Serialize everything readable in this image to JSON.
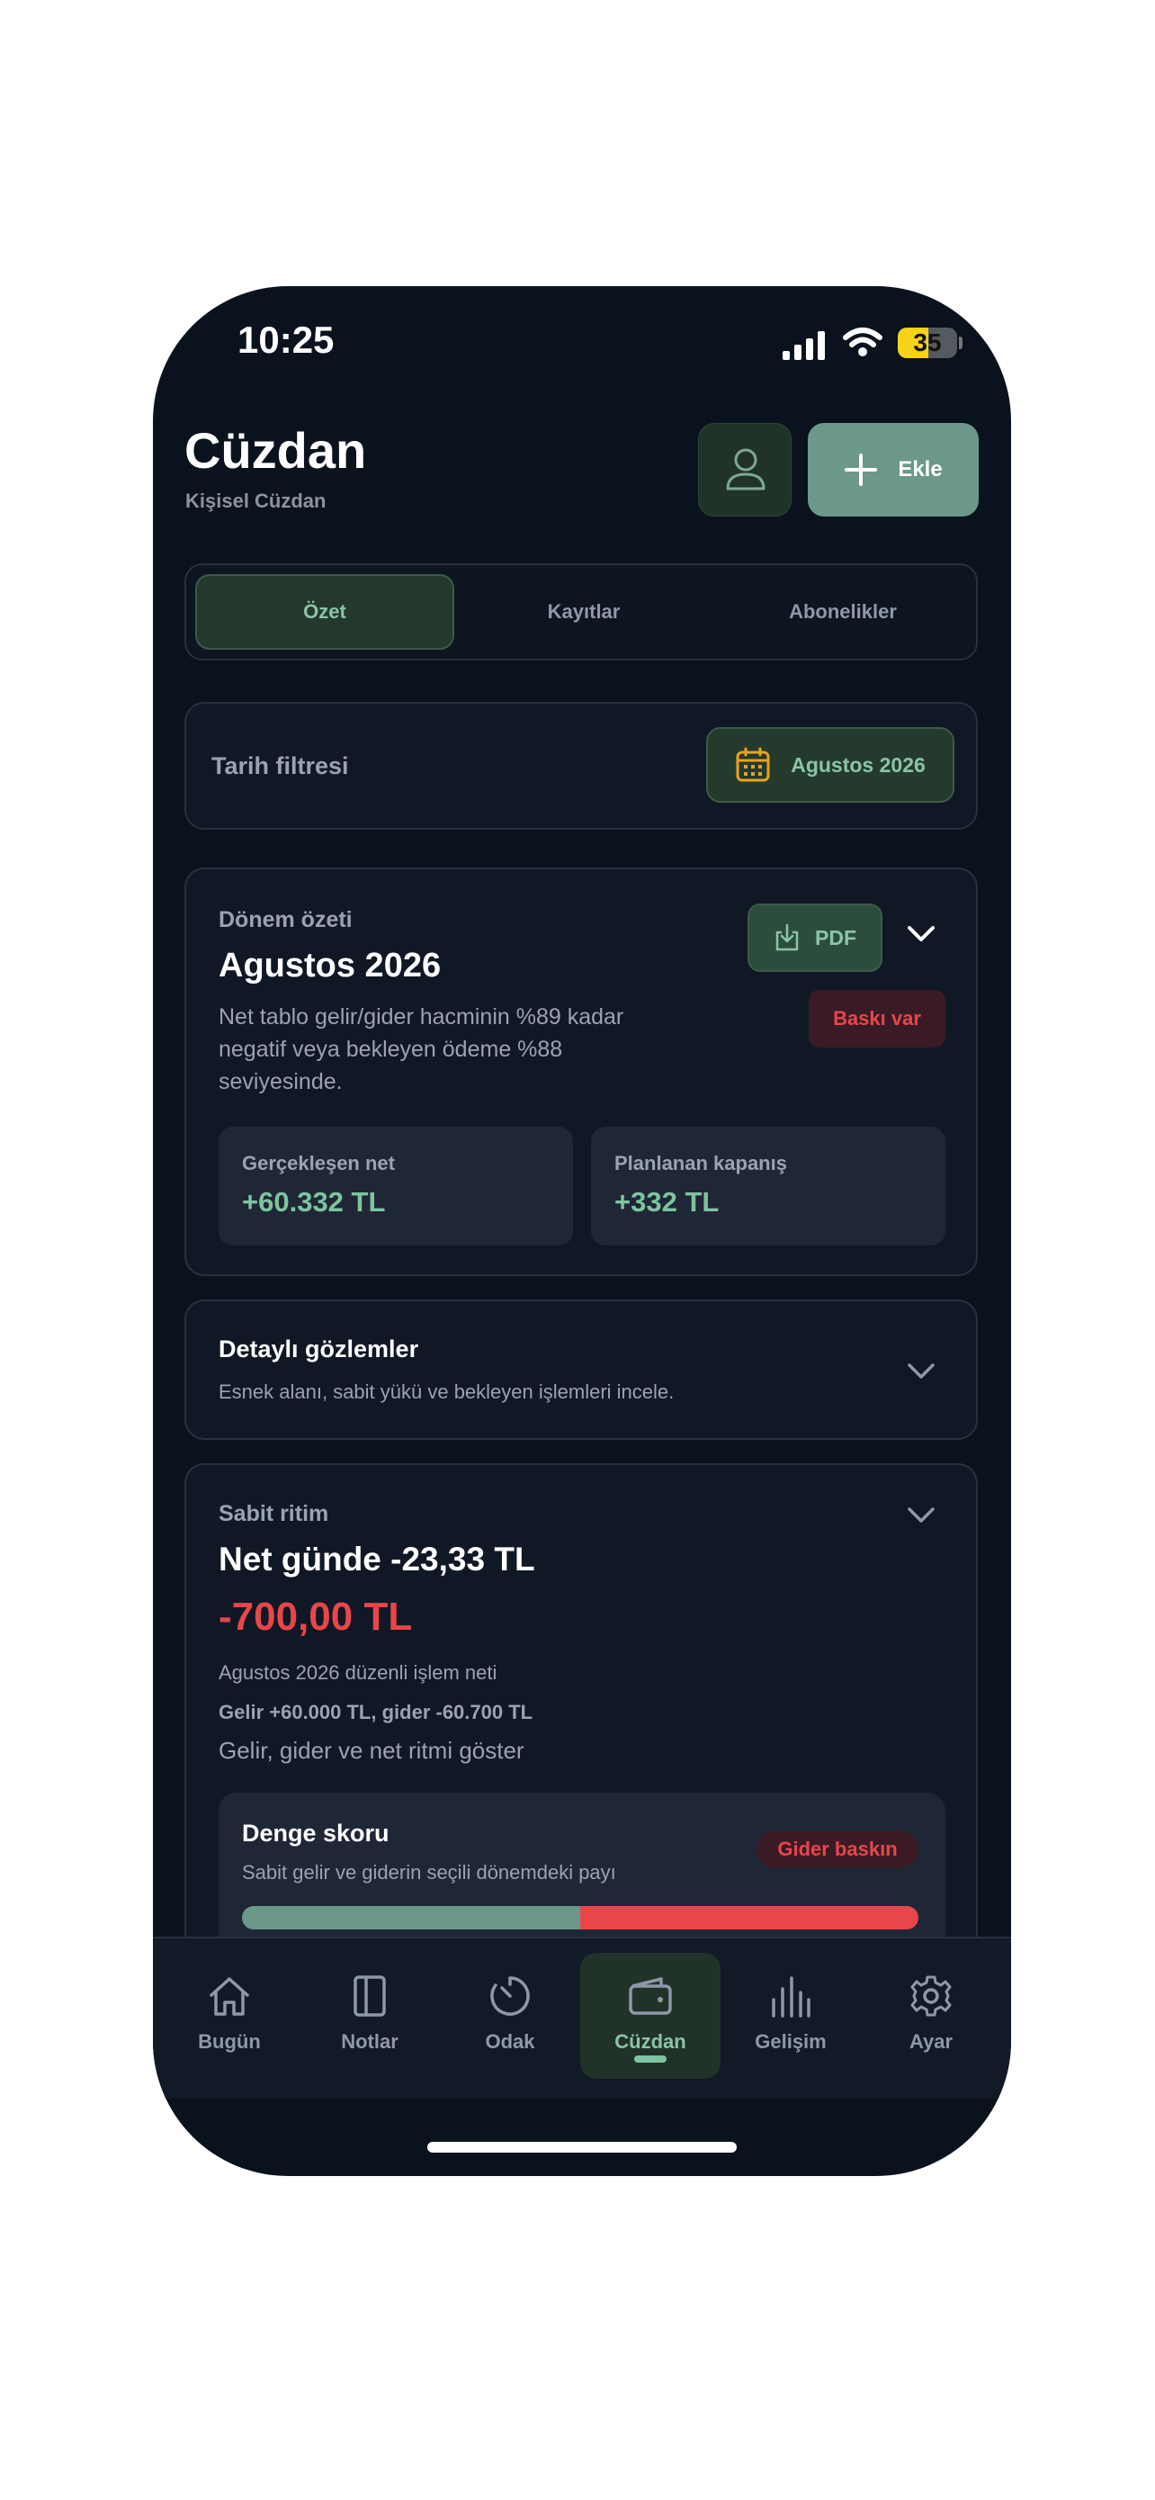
{
  "status": {
    "time": "10:25",
    "battery": "35"
  },
  "header": {
    "title": "Cüzdan",
    "subtitle": "Kişisel Cüzdan",
    "add_label": "Ekle"
  },
  "tabs": [
    {
      "label": "Özet",
      "active": true
    },
    {
      "label": "Kayıtlar",
      "active": false
    },
    {
      "label": "Abonelikler",
      "active": false
    }
  ],
  "filter": {
    "label": "Tarih filtresi",
    "date": "Agustos 2026"
  },
  "summary": {
    "section_label": "Dönem özeti",
    "period": "Agustos 2026",
    "description": "Net tablo gelir/gider hacminin %89 kadar negatif veya bekleyen ödeme %88 seviyesinde.",
    "pdf_label": "PDF",
    "badge": "Baskı var",
    "cards": [
      {
        "label": "Gerçekleşen net",
        "value": "+60.332 TL"
      },
      {
        "label": "Planlanan kapanış",
        "value": "+332 TL"
      }
    ]
  },
  "observations": {
    "title": "Detaylı gözlemler",
    "subtitle": "Esnek alanı, sabit yükü ve bekleyen işlemleri incele."
  },
  "rhythm": {
    "section_label": "Sabit ritim",
    "headline": "Net günde -23,33 TL",
    "amount": "-700,00 TL",
    "amount_caption": "Agustos 2026 düzenli işlem neti",
    "breakdown": "Gelir +60.000 TL, gider -60.700 TL",
    "toggle_text": "Gelir, gider ve net ritmi göster",
    "score": {
      "title": "Denge skoru",
      "subtitle": "Sabit gelir ve giderin seçili dönemdeki payı",
      "badge": "Gider baskın",
      "income_share": 0.5,
      "expense_share": 0.5
    }
  },
  "nav": [
    {
      "label": "Bugün",
      "icon": "home-icon"
    },
    {
      "label": "Notlar",
      "icon": "notebook-icon"
    },
    {
      "label": "Odak",
      "icon": "timer-icon"
    },
    {
      "label": "Cüzdan",
      "icon": "wallet-icon",
      "active": true
    },
    {
      "label": "Gelişim",
      "icon": "bar-chart-icon"
    },
    {
      "label": "Ayar",
      "icon": "gear-icon"
    }
  ],
  "colors": {
    "background": "#0a121d",
    "accent_green": "#7fc3a0",
    "button_green": "#6b988a",
    "danger": "#e8464a",
    "battery": "#f6d21a"
  }
}
